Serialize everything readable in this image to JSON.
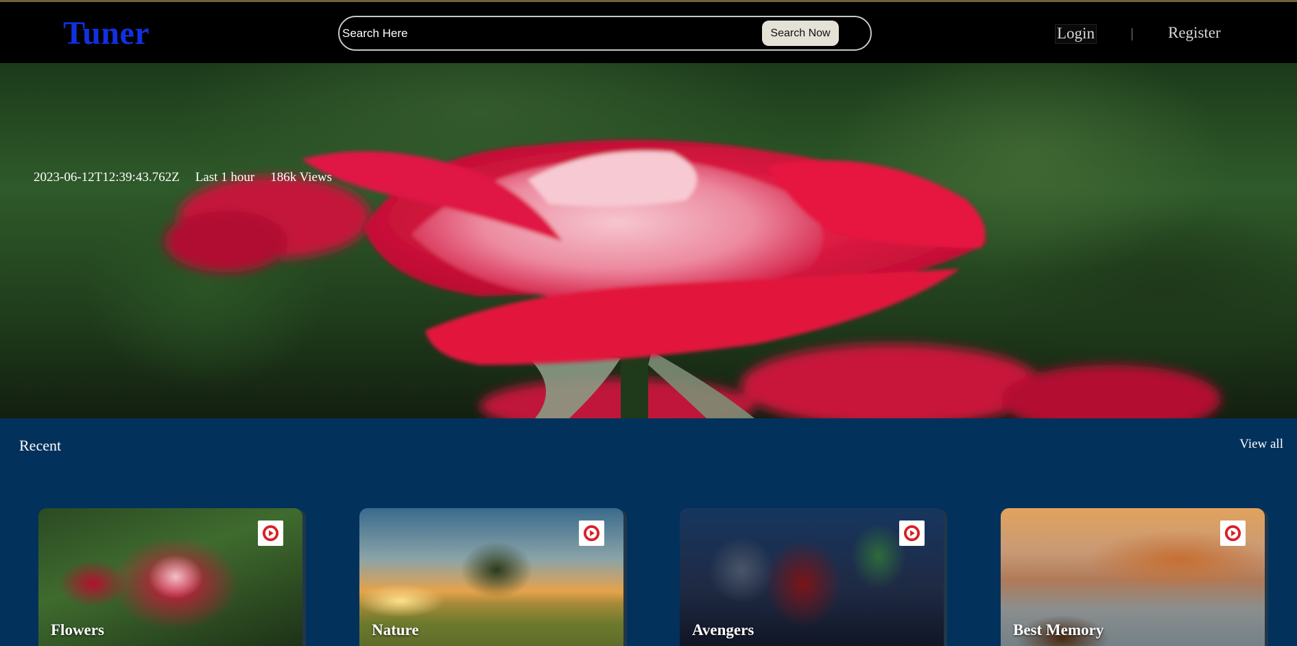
{
  "header": {
    "logo": "Tuner",
    "search": {
      "placeholder": "Search Here",
      "button_label": "Search Now"
    },
    "nav": {
      "login": "Login",
      "register": "Register"
    }
  },
  "hero": {
    "image": "rose-flower-photo",
    "timestamp": "2023-06-12T12:39:43.762Z",
    "duration": "Last 1 hour",
    "views": "186k Views"
  },
  "recent": {
    "title": "Recent",
    "view_all": "View all",
    "cards": [
      {
        "label": "Flowers",
        "image": "rose-photo",
        "icon": "play-icon"
      },
      {
        "label": "Nature",
        "image": "tree-sunset-photo",
        "icon": "play-icon"
      },
      {
        "label": "Avengers",
        "image": "avengers-poster",
        "icon": "play-icon"
      },
      {
        "label": "Best Memory",
        "image": "river-ghats-boat-photo",
        "icon": "play-icon"
      }
    ]
  },
  "colors": {
    "logo": "#1230e0",
    "header_bg": "#000000",
    "section_bg": "#02315c",
    "play_icon": "#d91f26"
  }
}
